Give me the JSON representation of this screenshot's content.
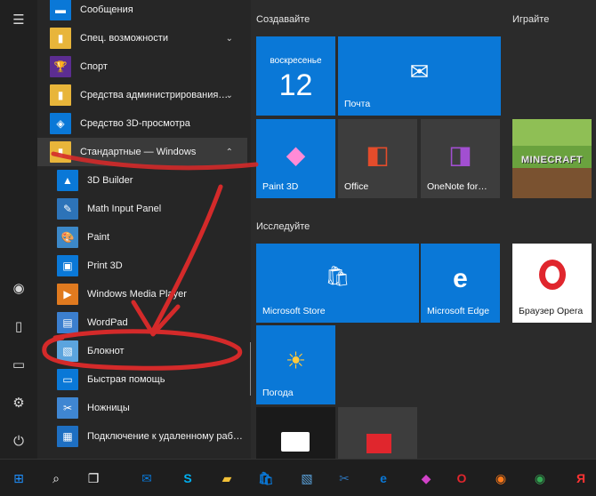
{
  "rail": {
    "icons": [
      "hamburger-icon",
      "user-icon",
      "document-icon",
      "pictures-icon",
      "settings-icon",
      "power-icon"
    ],
    "glyphs": [
      "☰",
      "◉",
      "▯",
      "▭",
      "⚙",
      "⏻"
    ]
  },
  "app_list": {
    "items": [
      {
        "label": "Сообщения",
        "color": "#0a78d7",
        "glyph": "▬",
        "sub": false
      },
      {
        "label": "Спец. возможности",
        "color": "#e8b53a",
        "glyph": "▮",
        "sub": false,
        "chevron": "⌄"
      },
      {
        "label": "Спорт",
        "color": "#5c2d91",
        "glyph": "🏆",
        "sub": false
      },
      {
        "label": "Средства администрирования…",
        "color": "#e8b53a",
        "glyph": "▮",
        "sub": false,
        "chevron": "⌄"
      },
      {
        "label": "Средство 3D-просмотра",
        "color": "#0a78d7",
        "glyph": "◈",
        "sub": false
      },
      {
        "label": "Стандартные — Windows",
        "color": "#e8b53a",
        "glyph": "▮",
        "sub": false,
        "chevron": "⌃",
        "open": true
      },
      {
        "label": "3D Builder",
        "color": "#0a78d7",
        "glyph": "▲",
        "sub": true
      },
      {
        "label": "Math Input Panel",
        "color": "#2d73b8",
        "glyph": "✎",
        "sub": true
      },
      {
        "label": "Paint",
        "color": "#3c88c8",
        "glyph": "🎨",
        "sub": true
      },
      {
        "label": "Print 3D",
        "color": "#0a78d7",
        "glyph": "▣",
        "sub": true
      },
      {
        "label": "Windows Media Player",
        "color": "#e07a1f",
        "glyph": "▶",
        "sub": true
      },
      {
        "label": "WordPad",
        "color": "#3b7fcf",
        "glyph": "▤",
        "sub": true
      },
      {
        "label": "Блокнот",
        "color": "#5ba4de",
        "glyph": "▧",
        "sub": true
      },
      {
        "label": "Быстрая помощь",
        "color": "#0a78d7",
        "glyph": "▭",
        "sub": true
      },
      {
        "label": "Ножницы",
        "color": "#3f86d2",
        "glyph": "✂",
        "sub": true
      },
      {
        "label": "Подключение к удаленному раб…",
        "color": "#1e6fc2",
        "glyph": "▦",
        "sub": true
      }
    ]
  },
  "groups": {
    "create": "Создавайте",
    "play": "Играйте",
    "explore": "Исследуйте"
  },
  "tiles": {
    "calendar_day": "воскресенье",
    "calendar_date": "12",
    "mail": "Почта",
    "paint3d": "Paint 3D",
    "office": "Office",
    "onenote": "OneNote for…",
    "minecraft": "MINECRAFT",
    "store": "Microsoft Store",
    "edge": "Microsoft Edge",
    "opera": "Браузер Opera",
    "weather": "Погода"
  },
  "taskbar": {
    "icons": [
      "start-icon",
      "search-icon",
      "task-view-icon",
      "mail-icon",
      "skype-icon",
      "explorer-icon",
      "store-icon",
      "notepad-icon",
      "snipping-icon",
      "edge-icon",
      "paint3d-icon",
      "opera-icon",
      "firefox-icon",
      "chrome-icon",
      "yandex-icon"
    ],
    "colors": [
      "#1e90ff",
      "#ffffff",
      "#ffffff",
      "#0a78d7",
      "#00aff0",
      "#f2c037",
      "#0a78d7",
      "#5ba4de",
      "#2d73b8",
      "#0a78d7",
      "#d142c8",
      "#e0262d",
      "#ff7a1a",
      "#34a853",
      "#ff3333"
    ],
    "glyphs": [
      "⊞",
      "⌕",
      "❐",
      "✉",
      "S",
      "▰",
      "🛍",
      "▧",
      "✂",
      "e",
      "◆",
      "O",
      "◉",
      "◉",
      "Я"
    ]
  },
  "colors": {
    "accent": "#0a78d7",
    "annotation": "#d42a2a"
  }
}
